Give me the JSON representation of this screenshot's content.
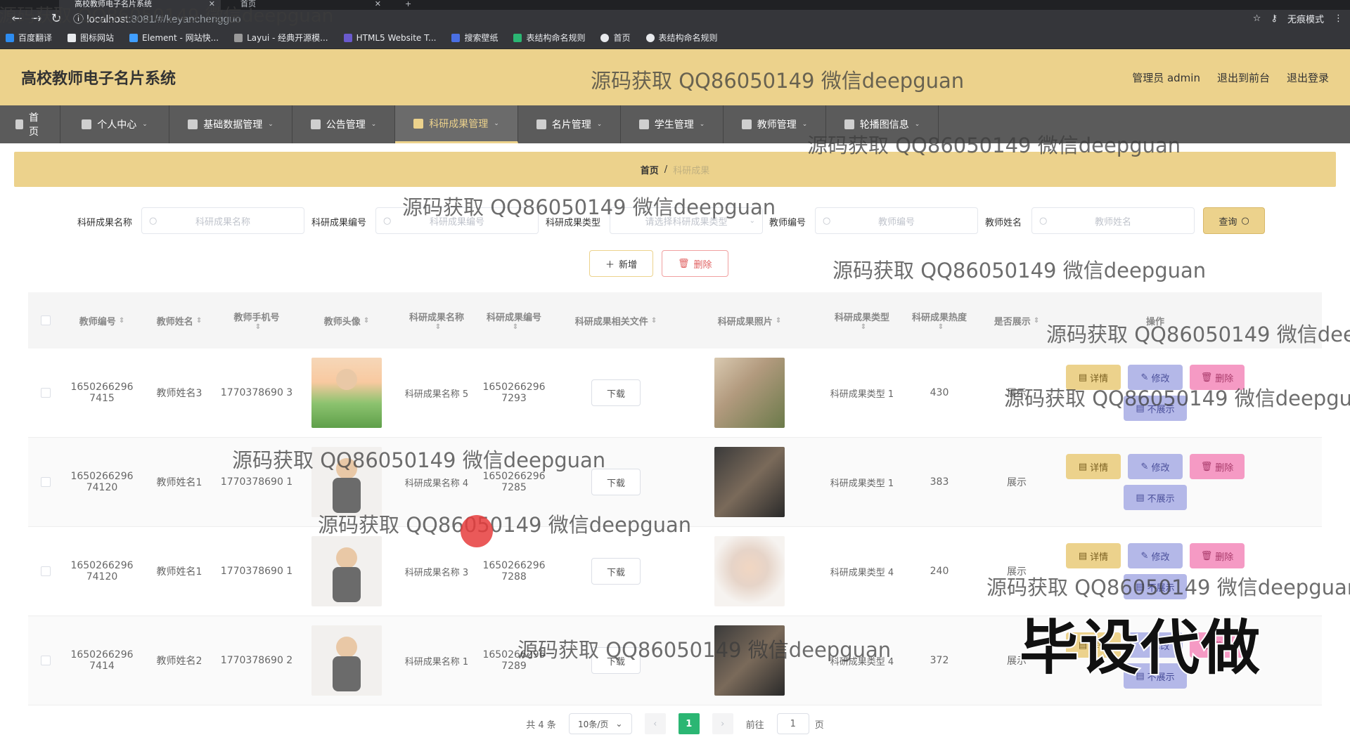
{
  "browser": {
    "tabs": [
      {
        "title": "高校教师电子名片系统"
      },
      {
        "title": "首页"
      }
    ],
    "url_host": "localhost",
    "url_path": ":8081/#/keyanchengguo",
    "profile": "无痕模式",
    "bookmarks": [
      "百度翻译",
      "图标网站",
      "Element - 网站快...",
      "Layui - 经典开源模...",
      "HTML5 Website T...",
      "搜索壁纸",
      "表结构命名规则",
      "首页",
      "表结构命名规则"
    ]
  },
  "header": {
    "title": "高校教师电子名片系统",
    "user": "管理员 admin",
    "to_front": "退出到前台",
    "logout": "退出登录"
  },
  "menu": [
    {
      "label": "首页",
      "icon": "home-icon"
    },
    {
      "label": "个人中心",
      "icon": "user-icon"
    },
    {
      "label": "基础数据管理",
      "icon": "user-icon"
    },
    {
      "label": "公告管理",
      "icon": "notice-icon"
    },
    {
      "label": "科研成果管理",
      "icon": "research-icon"
    },
    {
      "label": "名片管理",
      "icon": "card-icon"
    },
    {
      "label": "学生管理",
      "icon": "chart-icon"
    },
    {
      "label": "教师管理",
      "icon": "monitor-icon"
    },
    {
      "label": "轮播图信息",
      "icon": "flag-icon"
    }
  ],
  "breadcrumb": {
    "home": "首页",
    "sep": "/",
    "current": "科研成果"
  },
  "search": {
    "name_label": "科研成果名称",
    "name_ph": "科研成果名称",
    "code_label": "科研成果编号",
    "code_ph": "科研成果编号",
    "type_label": "科研成果类型",
    "type_ph": "请选择科研成果类型",
    "teacher_code_label": "教师编号",
    "teacher_code_ph": "教师编号",
    "teacher_name_label": "教师姓名",
    "teacher_name_ph": "教师姓名",
    "query": "查询"
  },
  "actions": {
    "add": "新增",
    "delete": "删除"
  },
  "table": {
    "headers": [
      "教师编号",
      "教师姓名",
      "教师手机号",
      "教师头像",
      "科研成果名称",
      "科研成果编号",
      "科研成果相关文件",
      "科研成果照片",
      "科研成果类型",
      "科研成果热度",
      "是否展示",
      "操作"
    ],
    "rows": [
      {
        "tno": "1650266296 7415",
        "tname": "教师姓名3",
        "phone": "1770378690 3",
        "rname": "科研成果名称 5",
        "rcode": "1650266296 7293",
        "file": "下载",
        "rtype": "科研成果类型 1",
        "heat": "430",
        "show": "展示",
        "hide_btn": "不展示"
      },
      {
        "tno": "1650266296 74120",
        "tname": "教师姓名1",
        "phone": "1770378690 1",
        "rname": "科研成果名称 4",
        "rcode": "1650266296 7285",
        "file": "下载",
        "rtype": "科研成果类型 1",
        "heat": "383",
        "show": "展示",
        "hide_btn": "不展示"
      },
      {
        "tno": "1650266296 74120",
        "tname": "教师姓名1",
        "phone": "1770378690 1",
        "rname": "科研成果名称 3",
        "rcode": "1650266296 7288",
        "file": "下载",
        "rtype": "科研成果类型 4",
        "heat": "240",
        "show": "展示",
        "hide_btn": "不展示"
      },
      {
        "tno": "1650266296 7414",
        "tname": "教师姓名2",
        "phone": "1770378690 2",
        "rname": "科研成果名称 1",
        "rcode": "1650266296 7289",
        "file": "下载",
        "rtype": "科研成果类型 4",
        "heat": "372",
        "show": "展示",
        "hide_btn": "不展示"
      }
    ],
    "op_detail": "详情",
    "op_edit": "修改",
    "op_delete": "删除"
  },
  "pagination": {
    "total": "共 4 条",
    "page_size": "10条/页",
    "current": "1",
    "goto": "前往",
    "goto_value": "1",
    "page_unit": "页"
  },
  "watermark": "源码获取 QQ86050149 微信deepguan",
  "overlay_text": "毕设代做",
  "colors": {
    "accent": "#ecd28c",
    "menu_bg": "#5b5b5b",
    "edit": "#b4b8e8",
    "delete": "#f59ac4",
    "page_active": "#2bb673"
  }
}
